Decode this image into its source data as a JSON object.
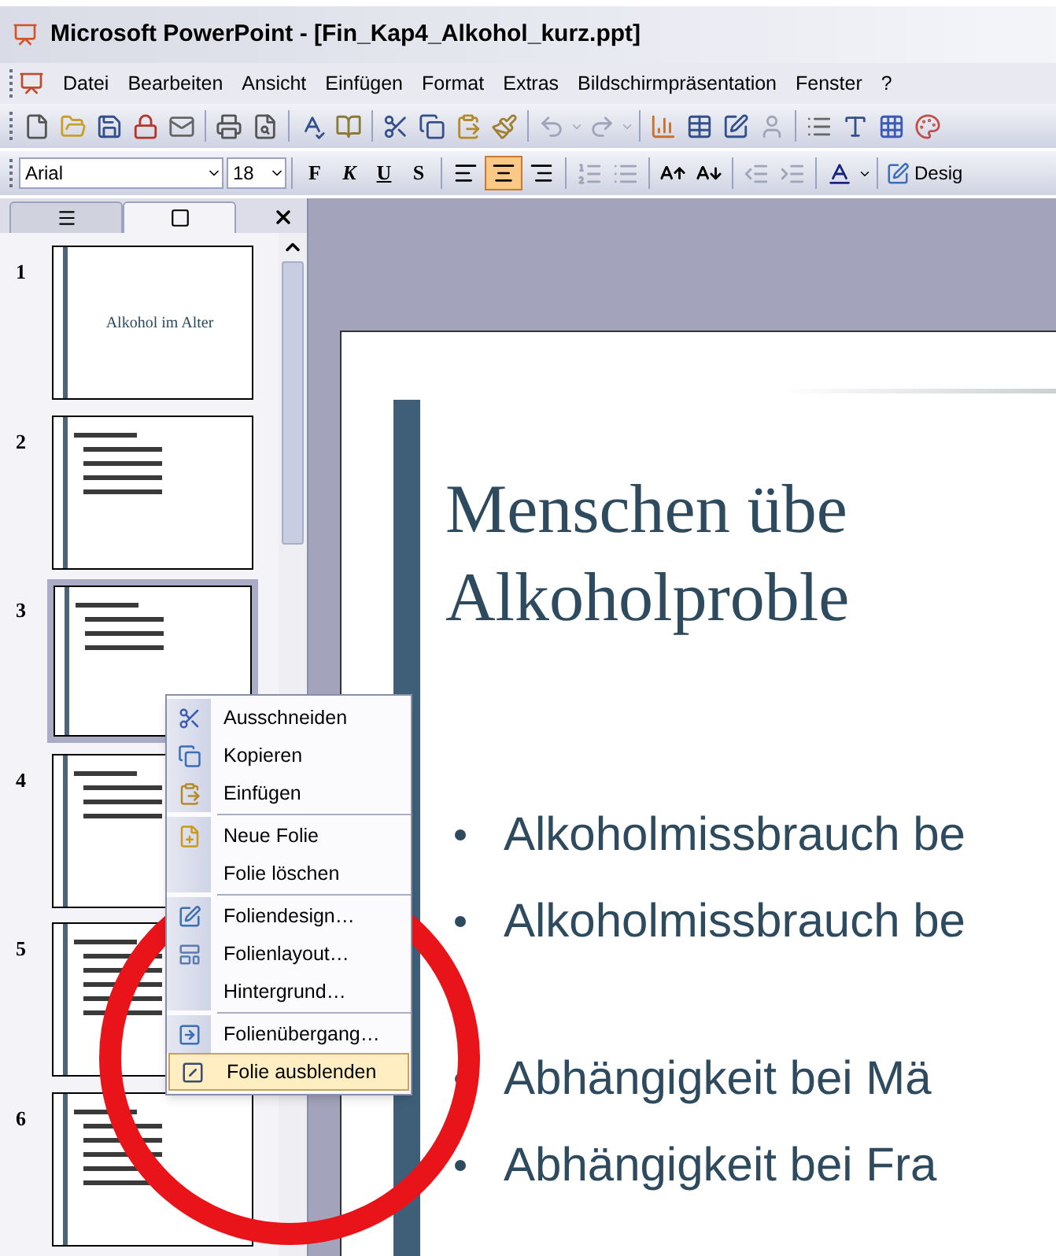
{
  "window": {
    "title": "Microsoft PowerPoint - [Fin_Kap4_Alkohol_kurz.ppt]"
  },
  "menu_bar": [
    "Datei",
    "Bearbeiten",
    "Ansicht",
    "Einfügen",
    "Format",
    "Extras",
    "Bildschirmpräsentation",
    "Fenster",
    "?"
  ],
  "formatting_toolbar": {
    "font": "Arial",
    "size": "18",
    "style_buttons": [
      "F",
      "K",
      "U",
      "S"
    ],
    "alignment_buttons": [
      {
        "selected": false
      },
      {
        "selected": true
      },
      {
        "selected": false
      }
    ],
    "design_button": "Desig"
  },
  "panel_tabs": [
    {
      "selected": false
    },
    {
      "selected": true
    }
  ],
  "slides": [
    {
      "number": "1",
      "title": "Alkohol im Alter",
      "selected": false
    },
    {
      "number": "2",
      "selected": false
    },
    {
      "number": "3",
      "selected": true
    },
    {
      "number": "4",
      "selected": false
    },
    {
      "number": "5",
      "selected": false
    },
    {
      "number": "6",
      "selected": false
    }
  ],
  "slide": {
    "title_lines": [
      "Menschen übe",
      "Alkoholproble"
    ],
    "bullet_groups": [
      [
        "Alkoholmissbrauch be",
        "Alkoholmissbrauch be"
      ],
      [
        "Abhängigkeit bei Mä",
        "Abhängigkeit bei Fra"
      ]
    ]
  },
  "context_menu": [
    {
      "label": "Ausschneiden",
      "separator_before": false,
      "selected": false
    },
    {
      "label": "Kopieren",
      "separator_before": false,
      "selected": false
    },
    {
      "label": "Einfügen",
      "separator_before": false,
      "selected": false
    },
    {
      "label": "Neue Folie",
      "separator_before": true,
      "selected": false
    },
    {
      "label": "Folie löschen",
      "separator_before": false,
      "selected": false
    },
    {
      "label": "Foliendesign…",
      "separator_before": true,
      "selected": false
    },
    {
      "label": "Folienlayout…",
      "separator_before": false,
      "selected": false
    },
    {
      "label": "Hintergrund…",
      "separator_before": false,
      "selected": false
    },
    {
      "label": "Folienübergang…",
      "separator_before": true,
      "selected": false
    },
    {
      "label": "Folie ausblenden",
      "separator_before": false,
      "selected": true
    }
  ]
}
